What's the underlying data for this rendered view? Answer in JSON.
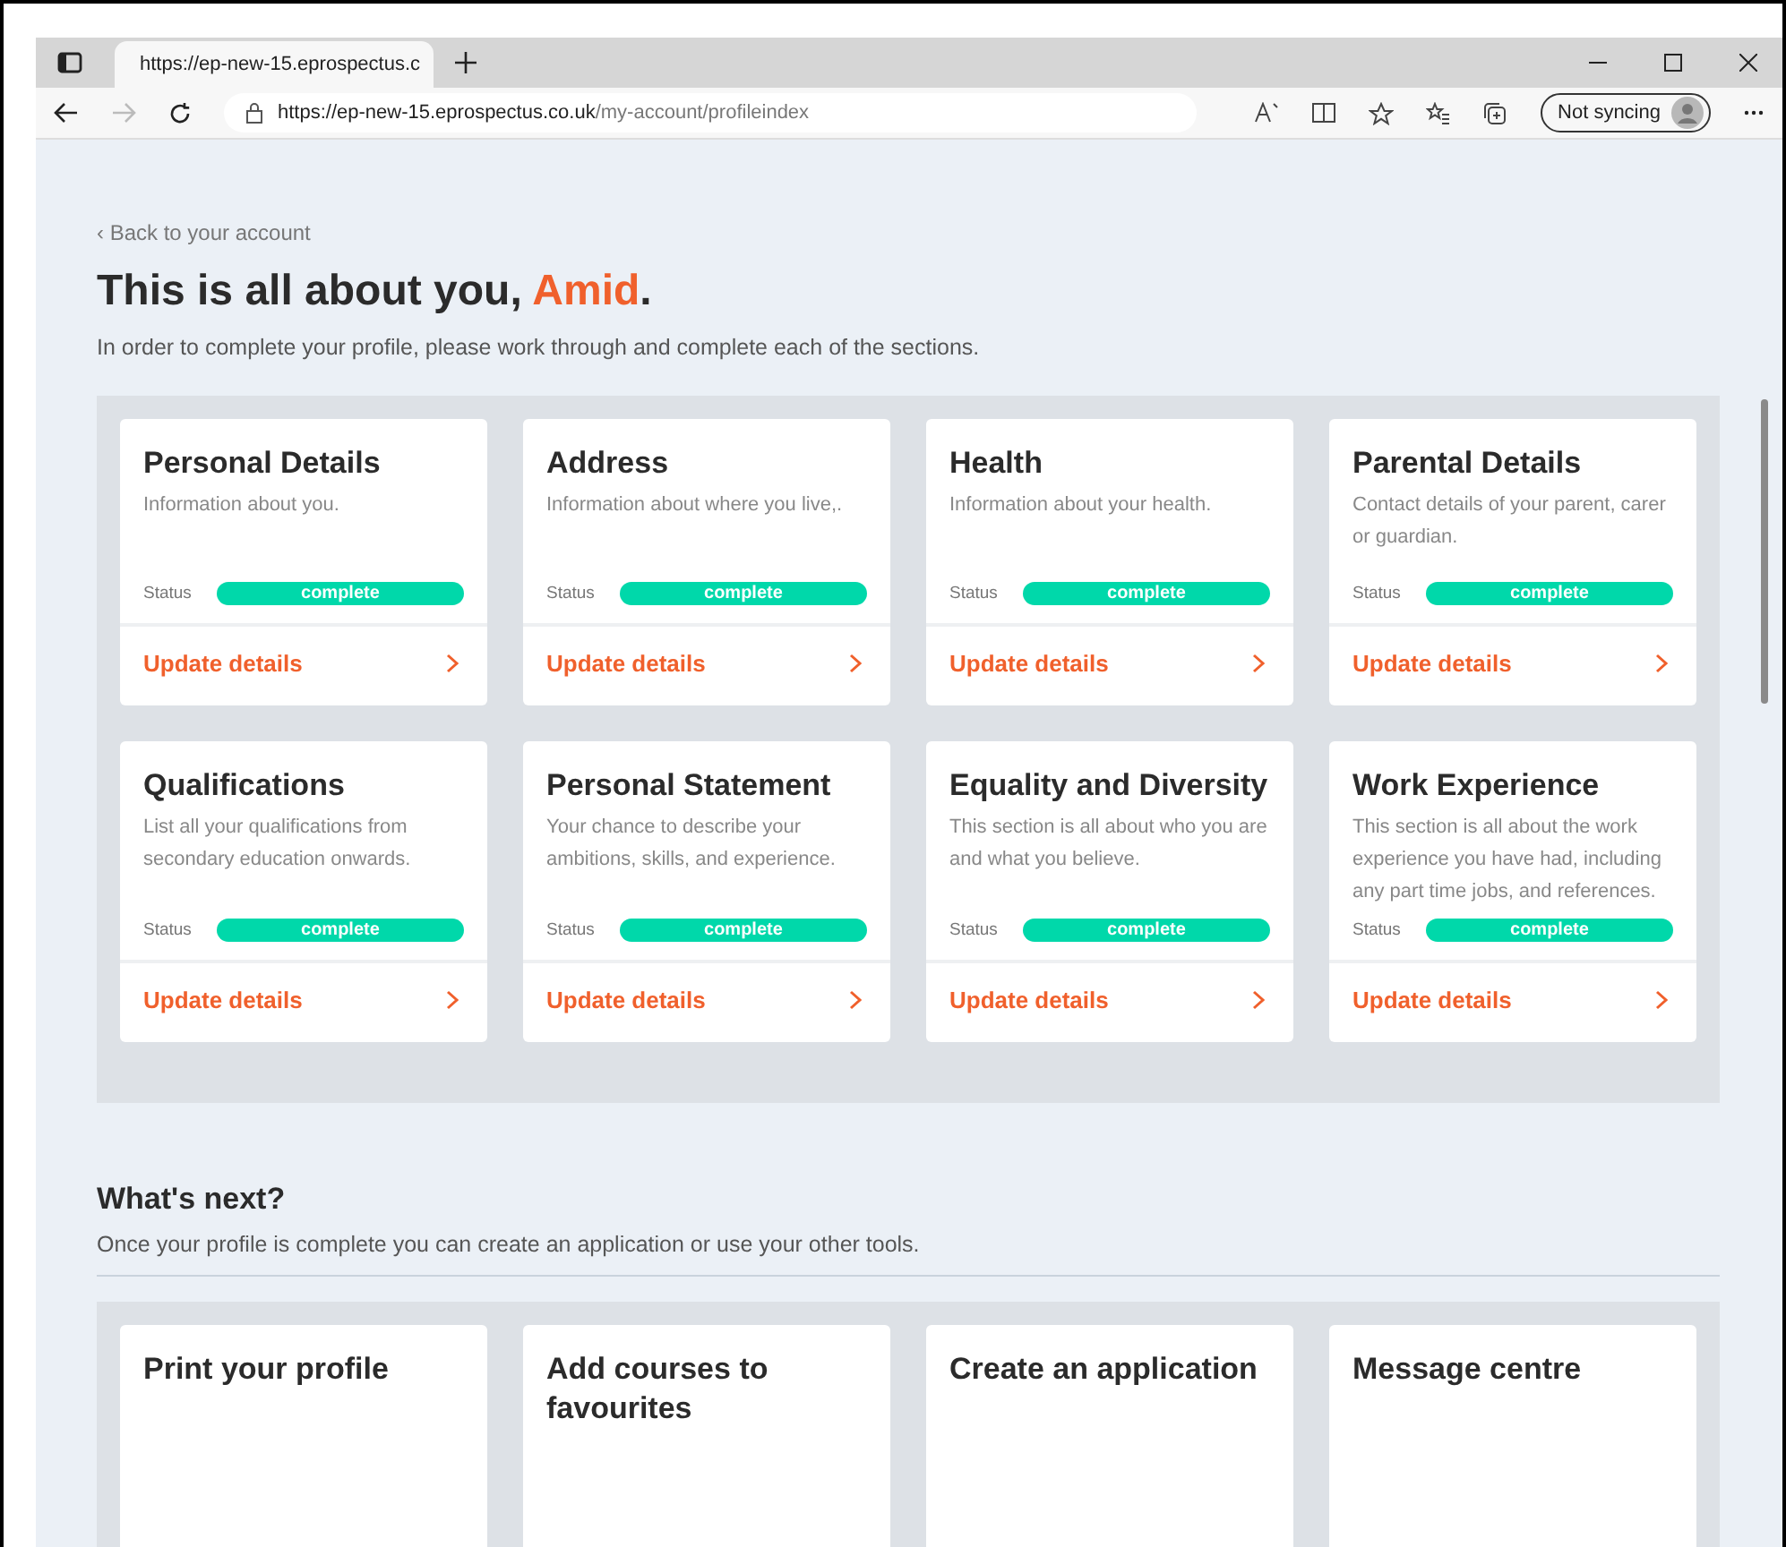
{
  "browser": {
    "tab_title": "https://ep-new-15.eprospectus.c",
    "url_host": "https://ep-new-15.eprospectus.co.uk",
    "url_path": "/my-account/profileindex",
    "sync_label": "Not syncing"
  },
  "back_link": "‹ Back to your account",
  "heading": {
    "text": "This is all about you, ",
    "name": "Amid",
    "end": "."
  },
  "intro": "In order to complete your profile, please work through and complete each of the sections.",
  "sections": [
    {
      "title": "Personal Details",
      "description": "Information about you.",
      "status_label": "Status",
      "status": "complete",
      "link": "Update details"
    },
    {
      "title": "Address",
      "description": "Information about where you live,.",
      "status_label": "Status",
      "status": "complete",
      "link": "Update details"
    },
    {
      "title": "Health",
      "description": "Information about your health.",
      "status_label": "Status",
      "status": "complete",
      "link": "Update details"
    },
    {
      "title": "Parental Details",
      "description": "Contact details of your parent, carer or guardian.",
      "status_label": "Status",
      "status": "complete",
      "link": "Update details"
    },
    {
      "title": "Qualifications",
      "description": "List all your qualifications from secondary education onwards.",
      "status_label": "Status",
      "status": "complete",
      "link": "Update details"
    },
    {
      "title": "Personal Statement",
      "description": "Your chance to describe your ambitions, skills, and experience.",
      "status_label": "Status",
      "status": "complete",
      "link": "Update details"
    },
    {
      "title": "Equality and Diversity",
      "description": "This section is all about who you are and what you believe.",
      "status_label": "Status",
      "status": "complete",
      "link": "Update details"
    },
    {
      "title": "Work Experience",
      "description": "This section is all about the work experience you have had, including any part time jobs, and references.",
      "status_label": "Status",
      "status": "complete",
      "link": "Update details"
    }
  ],
  "next": {
    "title": "What's next?",
    "intro": "Once your profile is complete you can create an application or use your other tools.",
    "tools": [
      {
        "title": "Print your profile"
      },
      {
        "title": "Add courses to favourites"
      },
      {
        "title": "Create an application"
      },
      {
        "title": "Message centre"
      }
    ]
  }
}
